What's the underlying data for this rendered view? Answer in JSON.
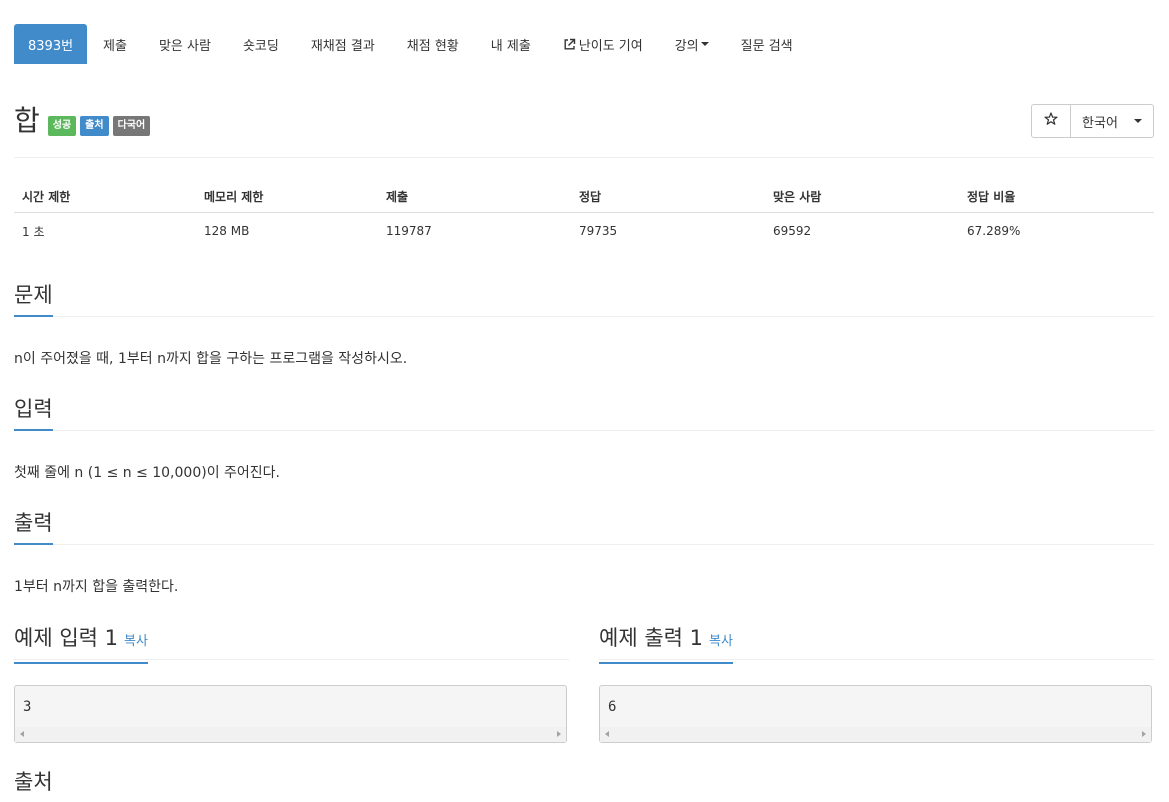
{
  "nav": {
    "problem_id": "8393번",
    "items": [
      "제출",
      "맞은 사람",
      "숏코딩",
      "재채점 결과",
      "채점 현황",
      "내 제출"
    ],
    "difficulty": "난이도 기여",
    "lecture": "강의",
    "qna": "질문 검색"
  },
  "problem": {
    "title": "합",
    "labels": [
      "성공",
      "출처",
      "다국어"
    ]
  },
  "toolbar": {
    "star_icon": "star-icon",
    "language": "한국어"
  },
  "stats": {
    "headers": [
      "시간 제한",
      "메모리 제한",
      "제출",
      "정답",
      "맞은 사람",
      "정답 비율"
    ],
    "values": [
      "1 초",
      "128 MB",
      "119787",
      "79735",
      "69592",
      "67.289%"
    ]
  },
  "sections": {
    "description": {
      "heading": "문제",
      "text": "n이 주어졌을 때, 1부터 n까지 합을 구하는 프로그램을 작성하시오."
    },
    "input": {
      "heading": "입력",
      "text": "첫째 줄에 n (1 ≤ n ≤ 10,000)이 주어진다."
    },
    "output": {
      "heading": "출력",
      "text": "1부터 n까지 합을 출력한다."
    },
    "source": {
      "heading": "출처"
    }
  },
  "samples": {
    "input_heading": "예제 입력 1",
    "output_heading": "예제 출력 1",
    "copy_label": "복사",
    "input_value": "3",
    "output_value": "6"
  },
  "colors": {
    "primary": "#428bca",
    "success": "#5cb85c",
    "default": "#777777"
  }
}
